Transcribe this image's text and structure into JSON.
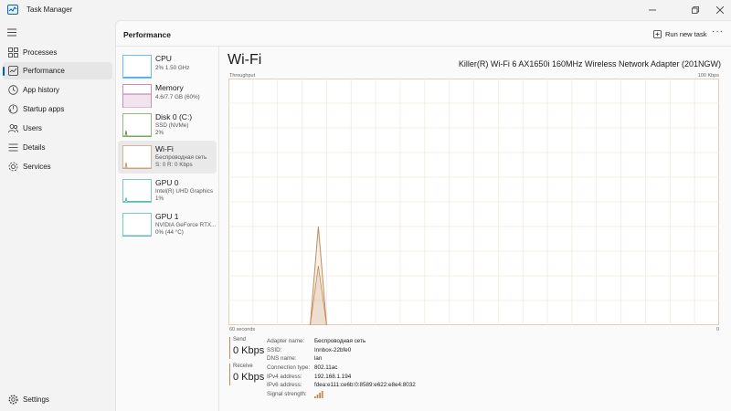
{
  "window": {
    "title": "Task Manager"
  },
  "nav": {
    "items": [
      {
        "label": "Processes",
        "icon": "processes-icon"
      },
      {
        "label": "Performance",
        "icon": "performance-icon"
      },
      {
        "label": "App history",
        "icon": "history-icon"
      },
      {
        "label": "Startup apps",
        "icon": "startup-icon"
      },
      {
        "label": "Users",
        "icon": "users-icon"
      },
      {
        "label": "Details",
        "icon": "details-icon"
      },
      {
        "label": "Services",
        "icon": "services-icon"
      }
    ],
    "settings_label": "Settings",
    "active": "Performance"
  },
  "header": {
    "title": "Performance",
    "run_task": "Run new task",
    "more": "···"
  },
  "devices": [
    {
      "name": "CPU",
      "lines": [
        "2%  1.50 GHz"
      ]
    },
    {
      "name": "Memory",
      "lines": [
        "4.6/7.7 GB (60%)"
      ]
    },
    {
      "name": "Disk 0 (C:)",
      "lines": [
        "SSD (NVMe)",
        "2%"
      ]
    },
    {
      "name": "Wi-Fi",
      "lines": [
        "Беспроводная сеть",
        "S: 0  R: 0 Kbps"
      ]
    },
    {
      "name": "GPU 0",
      "lines": [
        "Intel(R) UHD Graphics",
        "1%"
      ]
    },
    {
      "name": "GPU 1",
      "lines": [
        "NVIDIA GeForce RTX...",
        "0%  (44 °C)"
      ]
    }
  ],
  "detail": {
    "title": "Wi-Fi",
    "adapter": "Killer(R) Wi-Fi 6 AX1650i 160MHz Wireless Network Adapter (201NGW)",
    "throughput_label": "Throughput",
    "max_label": "100 Kbps",
    "time_left": "60 seconds",
    "time_right": "0",
    "send_label": "Send",
    "send_value": "0 Kbps",
    "receive_label": "Receive",
    "receive_value": "0 Kbps",
    "properties": [
      {
        "key": "Adapter name:",
        "value": "Беспроводная сеть"
      },
      {
        "key": "SSID:",
        "value": "Innbox-22bfe0"
      },
      {
        "key": "DNS name:",
        "value": "lan"
      },
      {
        "key": "Connection type:",
        "value": "802.11ac"
      },
      {
        "key": "IPv4 address:",
        "value": "192.168.1.194"
      },
      {
        "key": "IPv6 address:",
        "value": "fdea:e111:ce6b:0:8589:e622:e8e4:8032"
      },
      {
        "key": "Signal strength:",
        "value": ""
      }
    ]
  },
  "colors": {
    "accent": "#005fb8",
    "wifi": "#c38a56",
    "cpu": "#1192e8",
    "memory": "#9b4b8f",
    "disk": "#4c8a2a",
    "gpu": "#2aa5a0"
  },
  "chart_data": {
    "type": "area",
    "x": [
      60,
      59,
      58,
      57,
      56,
      55,
      54,
      53,
      52,
      51,
      50,
      49,
      48,
      47,
      46,
      45,
      44,
      43,
      42,
      41,
      40,
      39,
      38,
      37,
      36,
      35,
      34,
      33,
      32,
      31,
      30,
      29,
      28,
      27,
      26,
      25,
      24,
      23,
      22,
      21,
      20,
      19,
      18,
      17,
      16,
      15,
      14,
      13,
      12,
      11,
      10,
      9,
      8,
      7,
      6,
      5,
      4,
      3,
      2,
      1,
      0
    ],
    "series": [
      {
        "values": [
          null,
          null,
          null,
          null,
          null,
          null,
          null,
          null,
          null,
          null,
          0,
          40,
          0,
          null,
          null,
          null,
          null,
          null,
          null,
          null,
          null,
          null,
          null,
          null,
          null,
          null,
          null,
          null,
          null,
          null,
          null,
          null,
          null,
          null,
          null,
          null,
          null,
          null,
          null,
          null,
          null,
          null,
          null,
          null,
          null,
          null,
          null,
          null,
          null,
          null,
          null,
          null,
          null,
          null,
          null,
          null,
          null,
          null,
          null,
          null,
          null
        ]
      },
      {
        "values": [
          null,
          null,
          null,
          null,
          null,
          null,
          null,
          null,
          null,
          null,
          0,
          24,
          0,
          null,
          null,
          null,
          null,
          null,
          null,
          null,
          null,
          null,
          null,
          null,
          null,
          null,
          null,
          null,
          null,
          null,
          null,
          null,
          null,
          null,
          null,
          null,
          null,
          null,
          null,
          null,
          null,
          null,
          null,
          null,
          null,
          null,
          null,
          null,
          null,
          null,
          null,
          null,
          null,
          null,
          null,
          null,
          null,
          null,
          null,
          null,
          null
        ]
      }
    ],
    "xlim": [
      60,
      0
    ],
    "ylim": [
      0,
      100
    ],
    "grid": true
  }
}
